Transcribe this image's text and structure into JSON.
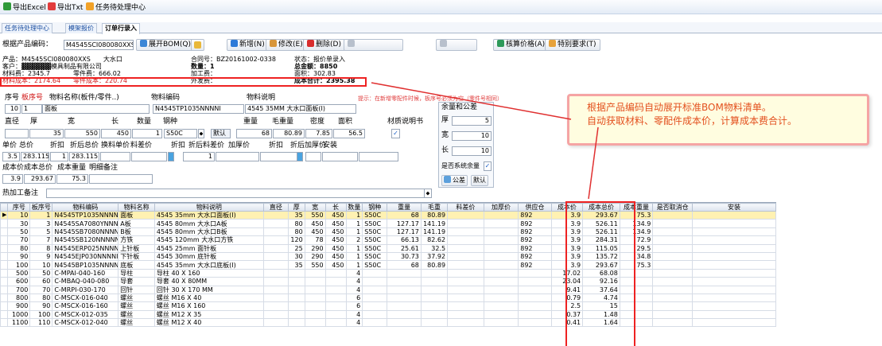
{
  "toolbar": {
    "export_excel": "导出Excel",
    "export_txt": "导出Txt",
    "task_center": "任务待处理中心"
  },
  "tabs": [
    "任务待处理中心",
    "模架报价",
    "订单行录入"
  ],
  "search": {
    "label": "根据产品编码：",
    "value": "M4545SCI080080XXS",
    "expand": "展开BOM(Q)",
    "add": "新增(N)",
    "edit": "修改(E)",
    "delete": "删除(D)",
    "calc": "核算价格(A)",
    "special": "特别要求(T)"
  },
  "info": {
    "product": "产品：M4545SCI080080XXS　　大水口",
    "contract": "合同号：BZ20161002-0338",
    "status": "状态：报价单录入",
    "customer": "客户：▓▓▓▓▓▓模具制品有限公司",
    "quantity": "数量：1",
    "total_amount": "总金额：8850",
    "material_cost": "材料费：2345.7",
    "parts_cost": "零件费：666.02",
    "processing": "加工费：",
    "area": "面积：302.83",
    "material_unit": "材料成本：2174.64",
    "parts_unit": "零件成本：220.74",
    "outsourcing": "外发费：",
    "cost_total": "成本合计：2395.38"
  },
  "form": {
    "h_seq": "序号",
    "h_bseq": "板序号",
    "h_name": "物料名称(板件/零件..)",
    "h_code": "物料编码",
    "h_desc": "物料说明",
    "hint": "提示：在新增零配件时候，板序号必须为空（零件号相同）",
    "seq": "10",
    "bseq": "1",
    "name": "面板",
    "code": "N4545TP1035NNNNI",
    "desc": "4545 35MM 大水口面板(I)",
    "h_dia": "直径",
    "h_thick": "厚",
    "h_width": "宽",
    "h_len": "长",
    "h_qty": "数量",
    "h_steel": "钢种",
    "h_weight": "重量",
    "h_gross": "毛重量",
    "h_density": "密度",
    "h_area": "面积",
    "h_cert": "材质说明书",
    "thick": "35",
    "width": "550",
    "len": "450",
    "qty": "1",
    "steel": "S50C",
    "default": "默认",
    "weight": "68",
    "gross": "80.89",
    "density": "7.85",
    "area": "56.5",
    "h_unit": "单价",
    "h_totalp": "总价",
    "h_disc": "折扣",
    "h_disc_total": "折后总价",
    "h_steel_unit": "换料单价",
    "h_steel_diff": "料差价",
    "h_disc2": "折扣",
    "h_disc2_diff": "折后料差价",
    "h_addp": "加厚价",
    "h_disc3": "折扣",
    "h_disc3_add": "折后加厚价",
    "h_install": "安装",
    "unit": "3.5",
    "totalp": "283.115",
    "disc": "1",
    "disc_total": "283.115",
    "disc2": "1",
    "h_cost_unit": "成本价",
    "h_cost_total": "成本总价",
    "h_cost_weight": "成本重量",
    "h_remark": "明细备注",
    "cost_unit": "3.9",
    "cost_total": "293.67",
    "cost_weight": "75.3",
    "h_heat": "热加工备注",
    "margin_title": "余量和公差",
    "m_thick": "厚",
    "m_thick_v": "5",
    "m_width": "宽",
    "m_width_v": "10",
    "m_len": "长",
    "m_len_v": "10",
    "sys_margin": "是否系统余量",
    "tol": "公差",
    "tol_default": "默认"
  },
  "annotation": [
    "根据产品编码自动展开标准BOM物料清单。",
    "自动获取材料、零配件成本价，计算成本费合计。"
  ],
  "table": {
    "headers": [
      "序号",
      "板序号",
      "物料编码",
      "物料名称",
      "物料说明",
      "直径",
      "厚",
      "宽",
      "长",
      "数量",
      "钢种",
      "重量",
      "毛重",
      "料差价",
      "加厚价",
      "供应仓",
      "成本价",
      "成本总价",
      "成本重量",
      "是否取消仓",
      "安装"
    ],
    "rows": [
      [
        "10",
        "1",
        "N4545TP1035NNNNI",
        "面板",
        "4545 35mm 大水口面板(I)",
        "",
        "35",
        "550",
        "450",
        "1",
        "S50C",
        "68",
        "80.89",
        "",
        "",
        "892",
        "3.9",
        "293.67",
        "75.3",
        "",
        ""
      ],
      [
        "30",
        "3",
        "N4545SA7080YNNNI",
        "A板",
        "4545 80mm 大水口A板",
        "",
        "80",
        "450",
        "450",
        "1",
        "S50C",
        "127.17",
        "141.19",
        "",
        "",
        "892",
        "3.9",
        "526.11",
        "134.9",
        "",
        ""
      ],
      [
        "50",
        "5",
        "N4545SB7080NNNNA",
        "B板",
        "4545 80mm 大水口B板",
        "",
        "80",
        "450",
        "450",
        "1",
        "S50C",
        "127.17",
        "141.19",
        "",
        "",
        "892",
        "3.9",
        "526.11",
        "134.9",
        "",
        ""
      ],
      [
        "70",
        "7",
        "N4545SB120NNNNN",
        "方铁",
        "4545 120mm 大水口方铁",
        "",
        "120",
        "78",
        "450",
        "2",
        "S50C",
        "66.13",
        "82.62",
        "",
        "",
        "892",
        "3.9",
        "284.31",
        "72.9",
        "",
        ""
      ],
      [
        "80",
        "8",
        "N4545ERP025NNNNA",
        "上针板",
        "4545 25mm 面针板",
        "",
        "25",
        "290",
        "450",
        "1",
        "S50C",
        "25.61",
        "32.5",
        "",
        "",
        "892",
        "3.9",
        "115.05",
        "29.5",
        "",
        ""
      ],
      [
        "90",
        "9",
        "N4545EJP030NNNNI",
        "下针板",
        "4545 30mm 底针板",
        "",
        "30",
        "290",
        "450",
        "1",
        "S50C",
        "30.73",
        "37.92",
        "",
        "",
        "892",
        "3.9",
        "135.72",
        "34.8",
        "",
        ""
      ],
      [
        "100",
        "10",
        "N4545BP1035NNNNI",
        "底板",
        "4545 35mm 大水口底板(I)",
        "",
        "35",
        "550",
        "450",
        "1",
        "S50C",
        "68",
        "80.89",
        "",
        "",
        "892",
        "3.9",
        "293.67",
        "75.3",
        "",
        ""
      ],
      [
        "500",
        "50",
        "C-MPAI-040-160",
        "导柱",
        "导柱 40 X 160",
        "",
        "",
        "",
        "",
        "4",
        "",
        "",
        "",
        "",
        "",
        "",
        "17.02",
        "68.08",
        "",
        "",
        ""
      ],
      [
        "600",
        "60",
        "C-MBAQ-040-080",
        "导套",
        "导套 40 X 80MM",
        "",
        "",
        "",
        "",
        "4",
        "",
        "",
        "",
        "",
        "",
        "",
        "23.04",
        "92.16",
        "",
        "",
        ""
      ],
      [
        "700",
        "70",
        "C-MRPI-030-170",
        "回针",
        "回针 30 X 170 MM",
        "",
        "",
        "",
        "",
        "4",
        "",
        "",
        "",
        "",
        "",
        "",
        "9.41",
        "37.64",
        "",
        "",
        ""
      ],
      [
        "800",
        "80",
        "C-MSCX-016-040",
        "螺丝",
        "螺丝 M16 X 40",
        "",
        "",
        "",
        "",
        "6",
        "",
        "",
        "",
        "",
        "",
        "",
        "0.79",
        "4.74",
        "",
        "",
        ""
      ],
      [
        "900",
        "90",
        "C-MSCX-016-160",
        "螺丝",
        "螺丝 M16 X 160",
        "",
        "",
        "",
        "",
        "6",
        "",
        "",
        "",
        "",
        "",
        "",
        "2.5",
        "15",
        "",
        "",
        ""
      ],
      [
        "1000",
        "100",
        "C-MSCX-012-035",
        "螺丝",
        "螺丝 M12 X 35",
        "",
        "",
        "",
        "",
        "4",
        "",
        "",
        "",
        "",
        "",
        "",
        "0.37",
        "1.48",
        "",
        "",
        ""
      ],
      [
        "1100",
        "110",
        "C-MSCX-012-040",
        "螺丝",
        "螺丝 M12 X 40",
        "",
        "",
        "",
        "",
        "4",
        "",
        "",
        "",
        "",
        "",
        "",
        "0.41",
        "1.64",
        "",
        "",
        ""
      ]
    ]
  }
}
